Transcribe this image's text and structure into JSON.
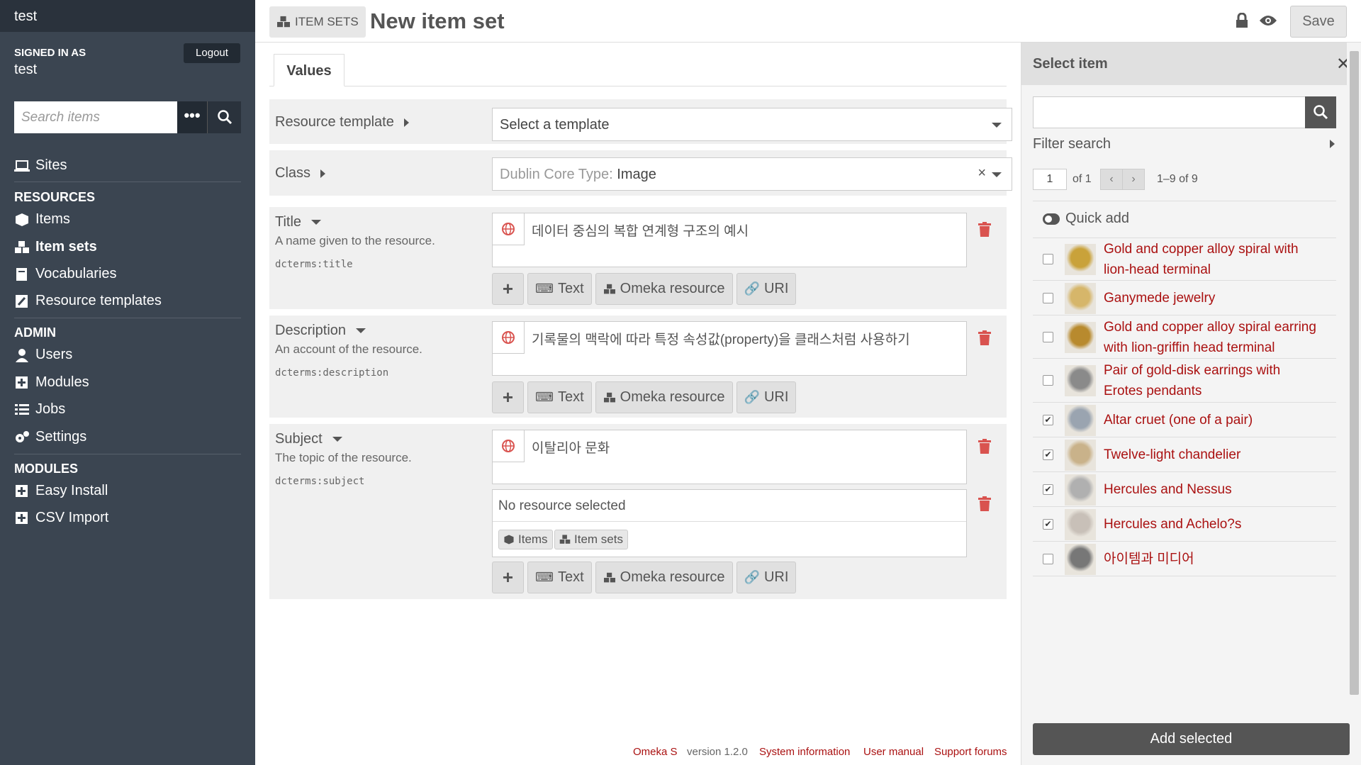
{
  "sidebar": {
    "site_name": "test",
    "signed_in_label": "SIGNED IN AS",
    "user": "test",
    "logout": "Logout",
    "search_placeholder": "Search items",
    "advanced_label": "•••",
    "sites": "Sites",
    "resources_head": "RESOURCES",
    "items": "Items",
    "item_sets": "Item sets",
    "vocabularies": "Vocabularies",
    "resource_templates": "Resource templates",
    "admin_head": "ADMIN",
    "users": "Users",
    "modules": "Modules",
    "jobs": "Jobs",
    "settings": "Settings",
    "modules_head": "MODULES",
    "easy_install": "Easy Install",
    "csv_import": "CSV Import"
  },
  "header": {
    "breadcrumb": "ITEM SETS",
    "title": "New item set",
    "save": "Save"
  },
  "tabs": {
    "values": "Values"
  },
  "form": {
    "resource_template_label": "Resource template",
    "resource_template_value": "Select a template",
    "class_label": "Class",
    "class_prefix": "Dublin Core Type:",
    "class_value": "Image",
    "title": {
      "label": "Title",
      "desc": "A name given to the resource.",
      "term": "dcterms:title",
      "value": "데이터 중심의 복합 연계형 구조의 예시"
    },
    "description": {
      "label": "Description",
      "desc": "An account of the resource.",
      "term": "dcterms:description",
      "value": "기록물의 맥락에 따라 특정 속성값(property)을 클래스처럼 사용하기"
    },
    "subject": {
      "label": "Subject",
      "desc": "The topic of the resource.",
      "term": "dcterms:subject",
      "value": "이탈리아 문화",
      "no_resource": "No resource selected",
      "chip_items": "Items",
      "chip_item_sets": "Item sets"
    },
    "btn_text": "Text",
    "btn_omeka": "Omeka resource",
    "btn_uri": "URI",
    "btn_plus": "+"
  },
  "footer": {
    "omeka": "Omeka S",
    "version": "version 1.2.0",
    "system_info": "System information",
    "manual": "User manual",
    "forums": "Support forums"
  },
  "panel": {
    "title": "Select item",
    "filter": "Filter search",
    "page": "1",
    "of": "of 1",
    "count": "1–9 of 9",
    "quick_add": "Quick add",
    "add_selected": "Add selected",
    "items": [
      {
        "title_l1": "Gold and copper alloy spiral with",
        "title_l2": "lion-head terminal",
        "checked": false
      },
      {
        "title_l1": "Ganymede jewelry",
        "title_l2": "",
        "checked": false
      },
      {
        "title_l1": "Gold and copper alloy spiral earring",
        "title_l2": "with lion-griffin head terminal",
        "checked": false
      },
      {
        "title_l1": "Pair of gold-disk earrings with",
        "title_l2": "Erotes pendants",
        "checked": false
      },
      {
        "title_l1": "Altar cruet (one of a pair)",
        "title_l2": "",
        "checked": true
      },
      {
        "title_l1": "Twelve-light chandelier",
        "title_l2": "",
        "checked": true
      },
      {
        "title_l1": "Hercules and Nessus",
        "title_l2": "",
        "checked": true
      },
      {
        "title_l1": "Hercules and Achelo?s",
        "title_l2": "",
        "checked": true
      },
      {
        "title_l1": "아이템과 미디어",
        "title_l2": "",
        "checked": false
      }
    ]
  },
  "colors": {
    "sidebar": "#3b4551",
    "link": "#a11111",
    "trash": "#d9534f"
  }
}
